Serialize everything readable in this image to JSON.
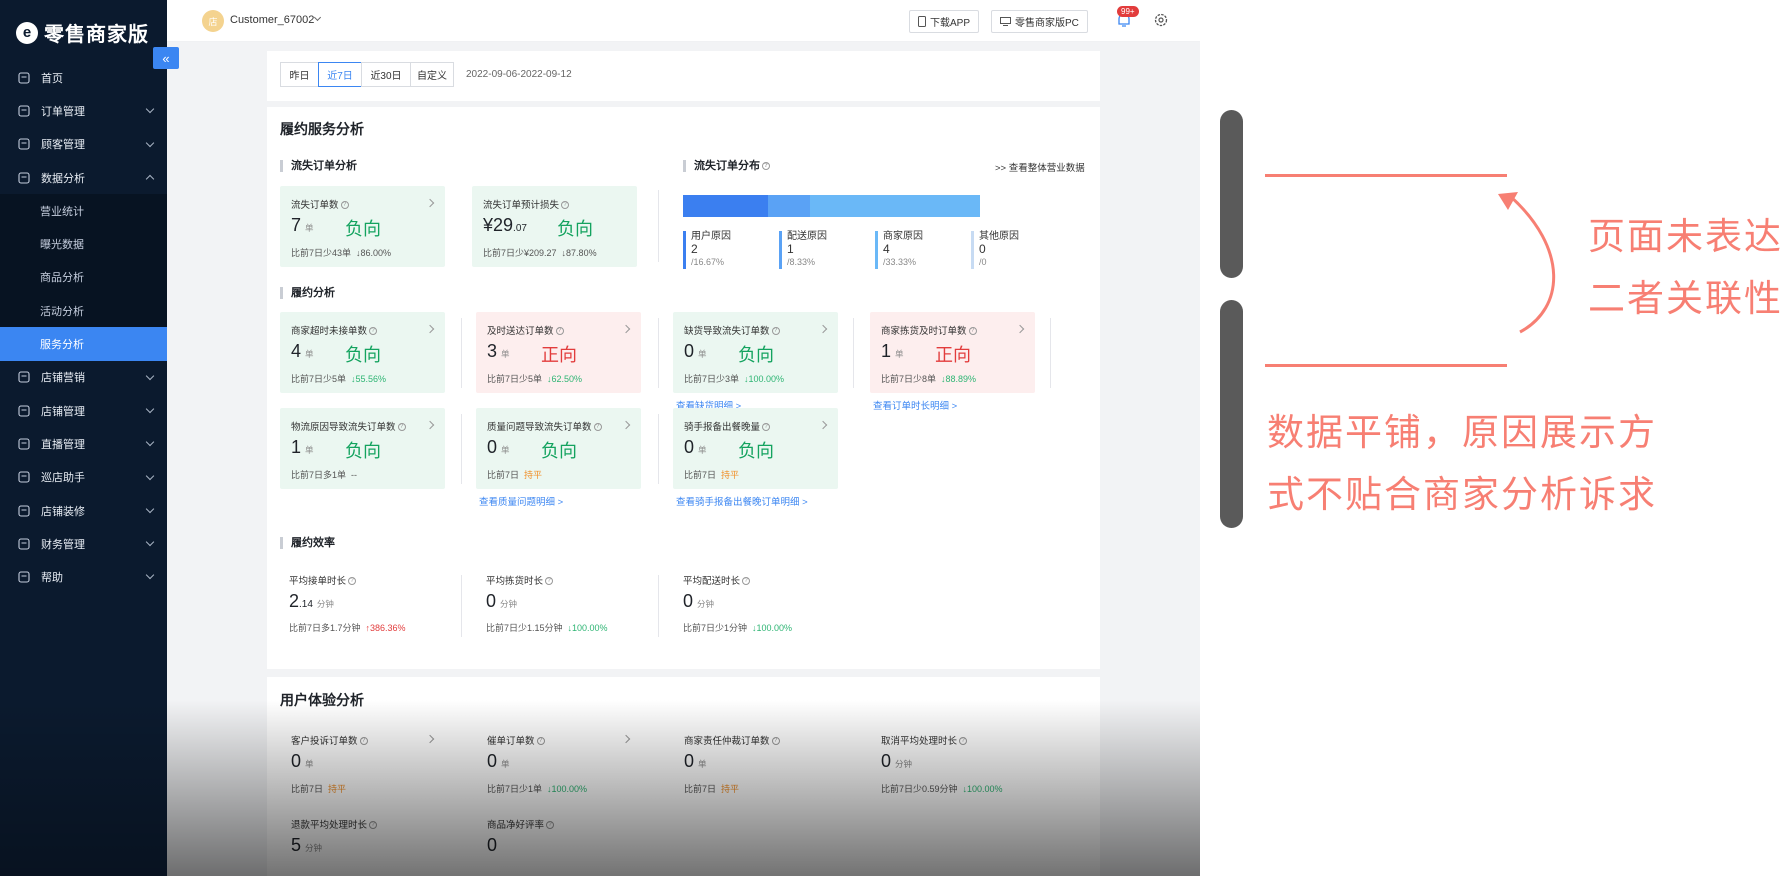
{
  "app": {
    "logo_mark": "e",
    "title": "零售商家版"
  },
  "sidebar": {
    "collapse": "«",
    "items": [
      {
        "label": "首页",
        "icon": "home-icon",
        "chevron": "none"
      },
      {
        "label": "订单管理",
        "icon": "order-icon",
        "chevron": "down"
      },
      {
        "label": "顾客管理",
        "icon": "customer-icon",
        "chevron": "down"
      },
      {
        "label": "数据分析",
        "icon": "chart-icon",
        "chevron": "up"
      },
      {
        "label": "店铺营销",
        "icon": "marketing-icon",
        "chevron": "down"
      },
      {
        "label": "店铺管理",
        "icon": "shop-settings-icon",
        "chevron": "down"
      },
      {
        "label": "直播管理",
        "icon": "live-icon",
        "chevron": "down"
      },
      {
        "label": "巡店助手",
        "icon": "patrol-icon",
        "chevron": "down"
      },
      {
        "label": "店铺装修",
        "icon": "decor-icon",
        "chevron": "down"
      },
      {
        "label": "财务管理",
        "icon": "finance-icon",
        "chevron": "down"
      },
      {
        "label": "帮助",
        "icon": "help-icon",
        "chevron": "down"
      }
    ],
    "sub_items": [
      {
        "label": "营业统计",
        "active": false
      },
      {
        "label": "曝光数据",
        "active": false
      },
      {
        "label": "商品分析",
        "active": false
      },
      {
        "label": "活动分析",
        "active": false
      },
      {
        "label": "服务分析",
        "active": true
      }
    ]
  },
  "header": {
    "avatar_text": "店",
    "username": "Customer_67002",
    "download_app": "下载APP",
    "pc_label": "零售商家版PC",
    "notification_count": "99+"
  },
  "date_filter": {
    "options": [
      "昨日",
      "近7日",
      "近30日",
      "自定义"
    ],
    "selected": "近7日",
    "range": "2022-09-06-2022-09-12"
  },
  "fulfillment": {
    "title": "履约服务分析",
    "lost_section": "流失订单分析",
    "lost_cards": [
      {
        "label": "流失订单数",
        "value": "7",
        "decimal": "",
        "unit": "单",
        "tag": "负向",
        "compare": "比前7日少43单",
        "delta": "↓86.00%"
      },
      {
        "label": "流失订单预计损失",
        "value": "¥29",
        "decimal": ".07",
        "unit": "",
        "tag": "负向",
        "compare": "比前7日少¥209.27",
        "delta": "↓87.80%"
      }
    ],
    "dist_title": "流失订单分布",
    "dist_link": ">> 查看整体营业数据",
    "distribution": [
      {
        "label": "用户原因",
        "count": "2",
        "pct": "/16.67%",
        "share": 0.2857,
        "color": "#3b7ff0"
      },
      {
        "label": "配送原因",
        "count": "1",
        "pct": "/8.33%",
        "share": 0.1429,
        "color": "#5aa2f5"
      },
      {
        "label": "商家原因",
        "count": "4",
        "pct": "/33.33%",
        "share": 0.5714,
        "color": "#6ab8f7"
      },
      {
        "label": "其他原因",
        "count": "0",
        "pct": "/0",
        "share": 0,
        "color": "#c7dbf3"
      }
    ],
    "perf_section": "履约分析",
    "perf_cards": [
      {
        "label": "商家超时未接单数",
        "value": "4",
        "unit": "单",
        "tag": "负向",
        "tone": "green",
        "compare": "比前7日少5单",
        "delta": "↓55.56%",
        "dir": "down",
        "link": ""
      },
      {
        "label": "及时送达订单数",
        "value": "3",
        "unit": "单",
        "tag": "正向",
        "tone": "red",
        "compare": "比前7日少5单",
        "delta": "↓62.50%",
        "dir": "down",
        "link": ""
      },
      {
        "label": "缺货导致流失订单数",
        "value": "0",
        "unit": "单",
        "tag": "负向",
        "tone": "green",
        "compare": "比前7日少3单",
        "delta": "↓100.00%",
        "dir": "down",
        "link": "查看缺货明细 >"
      },
      {
        "label": "商家拣货及时订单数",
        "value": "1",
        "unit": "单",
        "tag": "正向",
        "tone": "red",
        "compare": "比前7日少8单",
        "delta": "↓88.89%",
        "dir": "down",
        "link": "查看订单时长明细 >"
      },
      {
        "label": "物流原因导致流失订单数",
        "value": "1",
        "unit": "单",
        "tag": "负向",
        "tone": "green",
        "compare": "比前7日多1单",
        "delta": "--",
        "dir": "none",
        "link": ""
      },
      {
        "label": "质量问题导致流失订单数",
        "value": "0",
        "unit": "单",
        "tag": "负向",
        "tone": "green",
        "compare": "比前7日",
        "delta": "持平",
        "dir": "flat",
        "link": "查看质量问题明细 >"
      },
      {
        "label": "骑手报备出餐晚量",
        "value": "0",
        "unit": "单",
        "tag": "负向",
        "tone": "green",
        "compare": "比前7日",
        "delta": "持平",
        "dir": "flat",
        "link": "查看骑手报备出餐晚订单明细 >"
      }
    ],
    "eff_section": "履约效率",
    "efficiency": [
      {
        "label": "平均接单时长",
        "value": "2",
        "decimal": ".14",
        "unit": "分钟",
        "compare": "比前7日多1.7分钟",
        "delta": "↑386.36%",
        "dir": "up"
      },
      {
        "label": "平均拣货时长",
        "value": "0",
        "decimal": "",
        "unit": "分钟",
        "compare": "比前7日少1.15分钟",
        "delta": "↓100.00%",
        "dir": "down"
      },
      {
        "label": "平均配送时长",
        "value": "0",
        "decimal": "",
        "unit": "分钟",
        "compare": "比前7日少1分钟",
        "delta": "↓100.00%",
        "dir": "down"
      }
    ]
  },
  "experience": {
    "title": "用户体验分析",
    "cards": [
      {
        "label": "客户投诉订单数",
        "value": "0",
        "unit": "单",
        "compare": "比前7日",
        "delta": "持平",
        "dir": "flat"
      },
      {
        "label": "催单订单数",
        "value": "0",
        "unit": "单",
        "compare": "比前7日少1单",
        "delta": "↓100.00%",
        "dir": "down"
      },
      {
        "label": "商家责任仲裁订单数",
        "value": "0",
        "unit": "单",
        "compare": "比前7日",
        "delta": "持平",
        "dir": "flat"
      },
      {
        "label": "取消平均处理时长",
        "value": "0",
        "unit": "分钟",
        "compare": "比前7日少0.59分钟",
        "delta": "↓100.00%",
        "dir": "down"
      },
      {
        "label": "退款平均处理时长",
        "value": "5",
        "unit": "分钟",
        "compare": "",
        "delta": "",
        "dir": "none"
      },
      {
        "label": "商品净好评率",
        "value": "0",
        "unit": "",
        "compare": "",
        "delta": "",
        "dir": "none"
      }
    ]
  },
  "annotation": {
    "top_lines": [
      "页面未表达",
      "二者关联性"
    ],
    "bottom_lines": [
      "数据平铺，原因展示方",
      "式不贴合商家分析诉求"
    ],
    "color": "#f77f73"
  }
}
